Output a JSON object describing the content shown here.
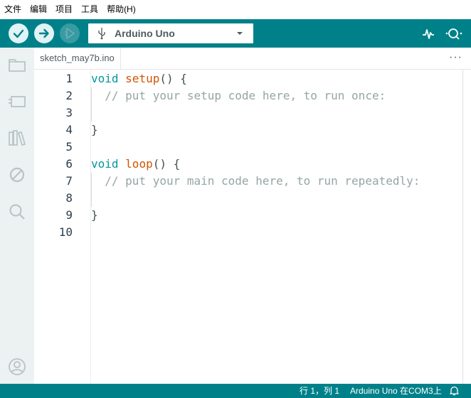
{
  "menu": {
    "items": [
      "文件",
      "编辑",
      "项目",
      "工具",
      "帮助(H)"
    ]
  },
  "toolbar": {
    "verify_icon": "check-icon",
    "upload_icon": "arrow-right-icon",
    "debug_icon": "debug-play-icon",
    "board_name": "Arduino Uno",
    "serial_plotter_icon": "pulse-icon",
    "serial_monitor_icon": "magnifier-dots-icon"
  },
  "sidebar": {
    "icons": [
      "folder-icon",
      "board-icon",
      "library-icon",
      "debug-circle-slash-icon",
      "search-icon",
      "account-icon"
    ]
  },
  "tabs": {
    "active": "sketch_may7b.ino",
    "more": "···"
  },
  "editor": {
    "line_numbers": [
      "1",
      "2",
      "3",
      "4",
      "5",
      "6",
      "7",
      "8",
      "9",
      "10"
    ],
    "lines": {
      "l1_kw": "void",
      "l1_fn": "setup",
      "l1_rest": "() {",
      "l2_comment": "// put your setup code here, to run once:",
      "l4": "}",
      "l6_kw": "void",
      "l6_fn": "loop",
      "l6_rest": "() {",
      "l7_comment": "// put your main code here, to run repeatedly:",
      "l9": "}"
    }
  },
  "status": {
    "position": "行 1，列 1",
    "board": "Arduino Uno 在COM3上",
    "bell_icon": "bell-icon"
  },
  "colors": {
    "teal": "#00818a",
    "keyword": "#00979d",
    "function": "#d35400",
    "comment": "#95a5a6"
  }
}
